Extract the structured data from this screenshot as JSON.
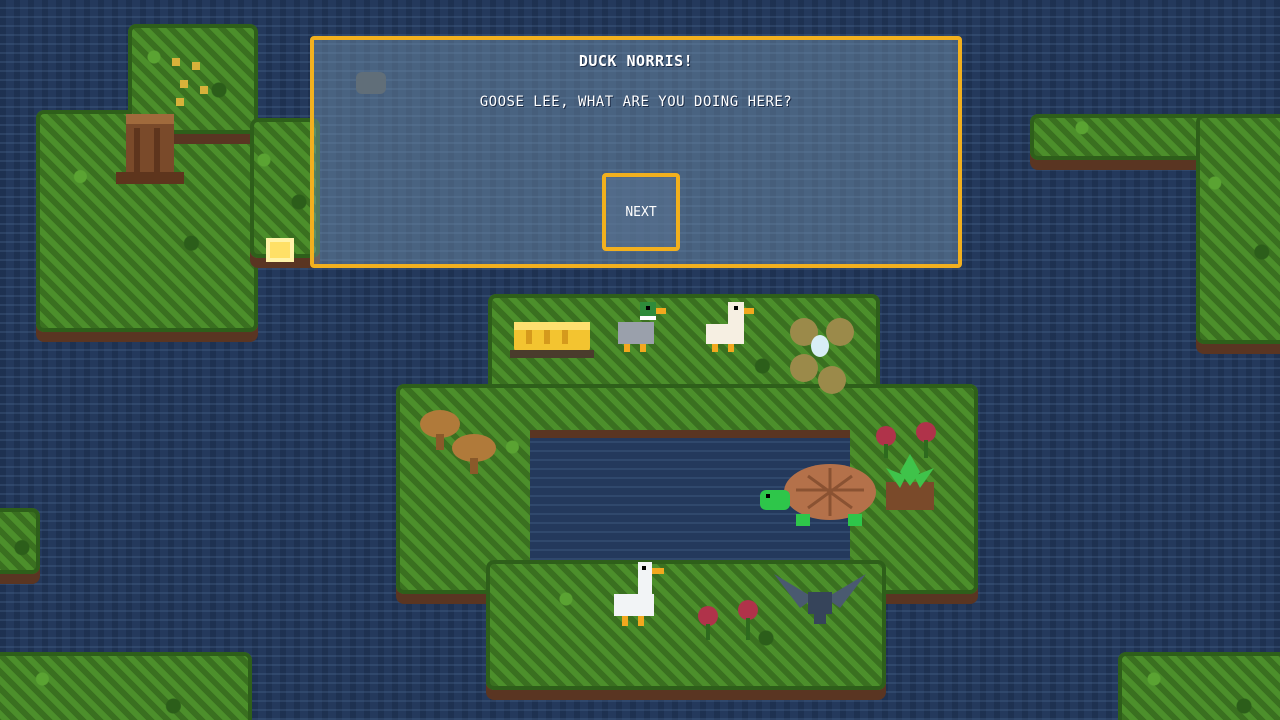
{
  "dialog": {
    "speaker": "DUCK NORRIS!",
    "text": "GOOSE LEE, WHAT ARE YOU DOING HERE?",
    "next_label": "NEXT"
  },
  "colors": {
    "water": "#24395c",
    "grass": "#3f7a24",
    "dirt": "#5a3522",
    "dialog_border": "#f2b01e"
  },
  "sprites": [
    "bread-icon",
    "mallard-duck-icon",
    "white-duck-icon",
    "egg-nest-icon",
    "turtle-icon",
    "goose-icon",
    "crow-icon",
    "tree-stump-icon",
    "mushroom-icon",
    "flower-icon",
    "potted-plant-icon",
    "lantern-icon"
  ]
}
